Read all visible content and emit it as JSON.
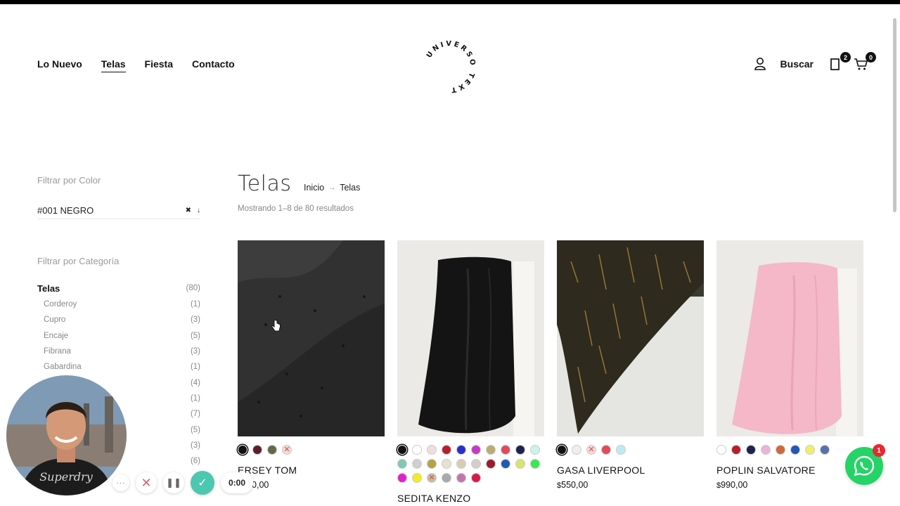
{
  "header": {
    "nav": [
      "Lo Nuevo",
      "Telas",
      "Fiesta",
      "Contacto"
    ],
    "active_nav": "Telas",
    "logo_text": "UNIVERSO TEXTIL",
    "search_label": "Buscar",
    "wishlist_count": "2",
    "cart_count": "0"
  },
  "sidebar": {
    "color_filter_label": "Filtrar por Color",
    "color_selected": "#001 NEGRO",
    "clear_glyph": "✖",
    "arrow_glyph": "↓",
    "category_filter_label": "Filtrar por Categoría",
    "top_category": {
      "name": "Telas",
      "count": "(80)"
    },
    "categories": [
      {
        "name": "Corderoy",
        "count": "(1)"
      },
      {
        "name": "Cupro",
        "count": "(3)"
      },
      {
        "name": "Encaje",
        "count": "(5)"
      },
      {
        "name": "Fibrana",
        "count": "(3)"
      },
      {
        "name": "Gabardina",
        "count": "(1)"
      },
      {
        "name": "",
        "count": "(4)"
      },
      {
        "name": "",
        "count": "(1)"
      },
      {
        "name": "",
        "count": "(7)"
      },
      {
        "name": "",
        "count": "(5)"
      },
      {
        "name": "",
        "count": "(3)"
      },
      {
        "name": "",
        "count": "(6)"
      }
    ]
  },
  "main": {
    "title": "Telas",
    "breadcrumb": [
      "Inicio",
      "Telas"
    ],
    "breadcrumb_sep": "→",
    "result_count": "Mostrando 1–8 de 80 resultados",
    "products": [
      {
        "name": "ERSEY TOM",
        "price_symbol": "$",
        "price": "550,00",
        "swatches": [
          {
            "color": "#111111",
            "selected": true
          },
          {
            "color": "#5c1f2a"
          },
          {
            "color": "#5f6b45"
          },
          {
            "color": "#f4dada",
            "crossed": true
          }
        ]
      },
      {
        "name": "SEDITA KENZO",
        "price_symbol": "",
        "price": "",
        "swatches": [
          {
            "color": "#111111",
            "selected": true
          },
          {
            "color": "#ffffff"
          },
          {
            "color": "#f2dcdc"
          },
          {
            "color": "#b81d2e"
          },
          {
            "color": "#2a2fc9"
          },
          {
            "color": "#c43cc4"
          },
          {
            "color": "#b9ad74"
          },
          {
            "color": "#e04a5a"
          },
          {
            "color": "#1c2350"
          },
          {
            "color": "#cdf2ea"
          },
          {
            "color": "#7fc9b4"
          },
          {
            "color": "#cfcfcf"
          },
          {
            "color": "#b3a341"
          },
          {
            "color": "#e8e0d0"
          },
          {
            "color": "#d8ccb4"
          },
          {
            "color": "#d2d0c8"
          },
          {
            "color": "#9a1b2c"
          },
          {
            "color": "#2158b6"
          },
          {
            "color": "#d8e46a"
          },
          {
            "color": "#38e84c"
          },
          {
            "color": "#e020c8"
          },
          {
            "color": "#f0ec20"
          },
          {
            "color": "#c8bca0",
            "crossed": true
          },
          {
            "color": "#a9a9a9"
          },
          {
            "color": "#c078a8"
          },
          {
            "color": "#d81a4a"
          }
        ]
      },
      {
        "name": "GASA LIVERPOOL",
        "price_symbol": "$",
        "price": "550,00",
        "swatches": [
          {
            "color": "#111111",
            "selected": true
          },
          {
            "color": "#eeeeee"
          },
          {
            "color": "#f6d8d8",
            "crossed": true
          },
          {
            "color": "#e04a5a"
          },
          {
            "color": "#bfeaf0"
          }
        ]
      },
      {
        "name": "POPLIN SALVATORE",
        "price_symbol": "$",
        "price": "990,00",
        "swatches": [
          {
            "color": "#ffffff"
          },
          {
            "color": "#b81d2e"
          },
          {
            "color": "#1c2350"
          },
          {
            "color": "#e8b4d8"
          },
          {
            "color": "#d0683c"
          },
          {
            "color": "#2158b6"
          },
          {
            "color": "#f2ee6a"
          },
          {
            "color": "#5870a8"
          }
        ]
      }
    ]
  },
  "recorder": {
    "timer": "0:00",
    "dots": "···",
    "cancel": "✕",
    "pause": "❚❚",
    "done": "✓"
  },
  "whatsapp": {
    "badge": "1",
    "color": "#25d366"
  }
}
